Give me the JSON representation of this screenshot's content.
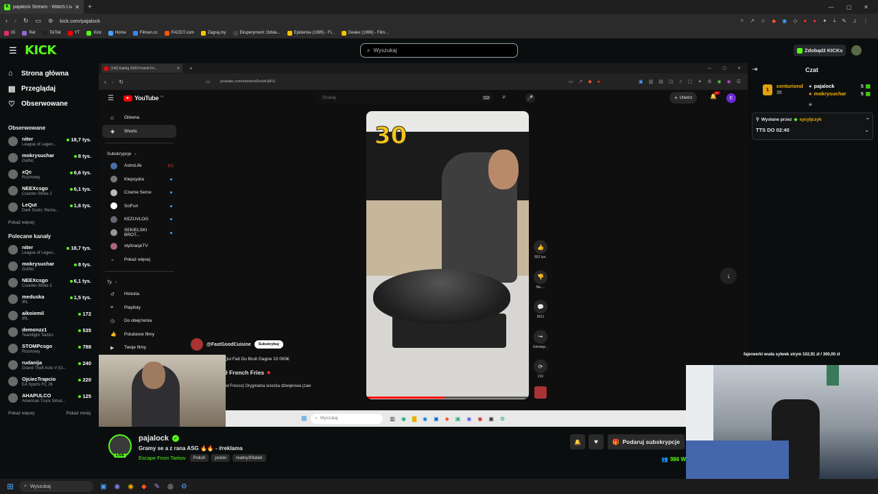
{
  "browser": {
    "tab_title": "pajalock Stream - Watch Live",
    "url": "kick.com/pajalock",
    "bookmarks": [
      {
        "label": "IG",
        "color": "#e1306c"
      },
      {
        "label": "Rat",
        "color": "#8e6bd4"
      },
      {
        "label": "TikTok",
        "color": "#222"
      },
      {
        "label": "YT",
        "color": "#ff0000"
      },
      {
        "label": "Kick",
        "color": "#53fc18"
      },
      {
        "label": "Home",
        "color": "#4aa3ff"
      },
      {
        "label": "Filman.cc",
        "color": "#3b82f6"
      },
      {
        "label": "FACEIT.com",
        "color": "#ff5500"
      },
      {
        "label": "Zagraj.my",
        "color": "#f5c400"
      },
      {
        "label": "Eksperyment: Odsła...",
        "color": "#444"
      },
      {
        "label": "Epidemia (1995) - Fi...",
        "color": "#f5c400"
      },
      {
        "label": "Dealer (1996) - Film...",
        "color": "#f5c400"
      }
    ]
  },
  "header": {
    "logo": "KICK",
    "search_placeholder": "Wyszukaj",
    "get_kicks": "Zdobądź KICKs"
  },
  "sidebar": {
    "nav": [
      {
        "label": "Strona główna",
        "icon": "home-icon"
      },
      {
        "label": "Przeglądaj",
        "icon": "browse-icon"
      },
      {
        "label": "Obserwowane",
        "icon": "heart-icon"
      }
    ],
    "followed_title": "Obserwowane",
    "followed": [
      {
        "name": "niter",
        "game": "League of Legen...",
        "viewers": "18,7 tys."
      },
      {
        "name": "mokrysuchar",
        "game": "Gothic",
        "viewers": "8 tys."
      },
      {
        "name": "xQc",
        "game": "Rozmowy",
        "viewers": "6,6 tys."
      },
      {
        "name": "NEEXcsgo",
        "game": "Counter-Strike 2",
        "viewers": "6,1 tys."
      },
      {
        "name": "LeQut",
        "game": "Dark Souls: Rema...",
        "viewers": "1,6 tys."
      }
    ],
    "show_more": "Pokaż więcej",
    "recommended_title": "Polecane kanały",
    "recommended": [
      {
        "name": "niter",
        "game": "League of Legen...",
        "viewers": "18,7 tys."
      },
      {
        "name": "mokrysuchar",
        "game": "Gothic",
        "viewers": "8 tys."
      },
      {
        "name": "NEEXcsgo",
        "game": "Counter-Strike 2",
        "viewers": "6,1 tys."
      },
      {
        "name": "meduska",
        "game": "IRL",
        "viewers": "1,5 tys."
      },
      {
        "name": "aikoiemil",
        "game": "IRL",
        "viewers": "172"
      },
      {
        "name": "demonzz1",
        "game": "Teamfight Tactics",
        "viewers": "535"
      },
      {
        "name": "STOMPcsgo",
        "game": "Rozmowy",
        "viewers": "788"
      },
      {
        "name": "rudanija",
        "game": "Grand Theft Auto V (O...",
        "viewers": "240"
      },
      {
        "name": "OjciecTrapcio",
        "game": "EA Sports FC 26",
        "viewers": "220"
      },
      {
        "name": "AHAPULCO",
        "game": "American Truck Simul...",
        "viewers": "125"
      }
    ],
    "show_less": "Pokaż mniej"
  },
  "inner_browser": {
    "tab_title": "(142) Eating 1000 French Fri...",
    "url": "youtube.com/shorts/xlZe4zFj9FU"
  },
  "youtube": {
    "logo": "YouTube",
    "country": "PL",
    "search_placeholder": "Szukaj",
    "create": "Utwórz",
    "notif": "9+",
    "avatar": "E",
    "nav": [
      {
        "label": "Główna"
      },
      {
        "label": "Shorts"
      }
    ],
    "subs_title": "Subskrypcje",
    "subs": [
      "AstroLife",
      "Klepsydra",
      "Czarne Serce",
      "SciFun",
      "KEZUVLOG",
      "SEKIELSKI BROT...",
      "stylizacjeTV"
    ],
    "show_more": "Pokaż więcej",
    "you_title": "Ty",
    "you_items": [
      "Historia",
      "Playlisty",
      "Do obejrzenia",
      "Polubione filmy",
      "Twoje filmy"
    ],
    "short": {
      "overlay_number": "30",
      "channel": "@FastGoodCuisine",
      "subscribe": "Subskrybuj",
      "line1": "Qui Fait Du Bruit Gagne 10 000€",
      "line2": "9 French Fries",
      "audio": "ed Fresco)   Oryginalna ścieżka dźwiękowa (zaw",
      "likes": "852 tys.",
      "dislike": "Nie ...",
      "comments": "3611",
      "share": "Udostęp...",
      "remix": "216"
    },
    "taskbar_search": "Wyszukaj"
  },
  "chat": {
    "title": "Czat",
    "gifter_top": "centuriond",
    "gifter_count": "35",
    "gifters": [
      {
        "name": "pajalock",
        "count": "5"
      },
      {
        "name": "mokrysuchar",
        "count": "5"
      }
    ],
    "pinned_prefix": "Wysłane przez",
    "pinned_user": "sycyljczyk",
    "pinned_text": "TTS DO 02:40",
    "overlay_text": "fajerwerki wuda sylwek strym 102,91 zł / 300,00 zł"
  },
  "streamer": {
    "name": "pajalock",
    "title": "Gramy se a z rana ASG 🔥🔥 - #reklama",
    "category": "Escape From Tarkov",
    "tags": [
      "Polish",
      "polski",
      "realny30latek"
    ],
    "live": "LIVE",
    "subscribe_gift": "Podaruj subskrypcje",
    "viewers": "986 W"
  },
  "taskbar": {
    "search": "Wyszukaj"
  }
}
